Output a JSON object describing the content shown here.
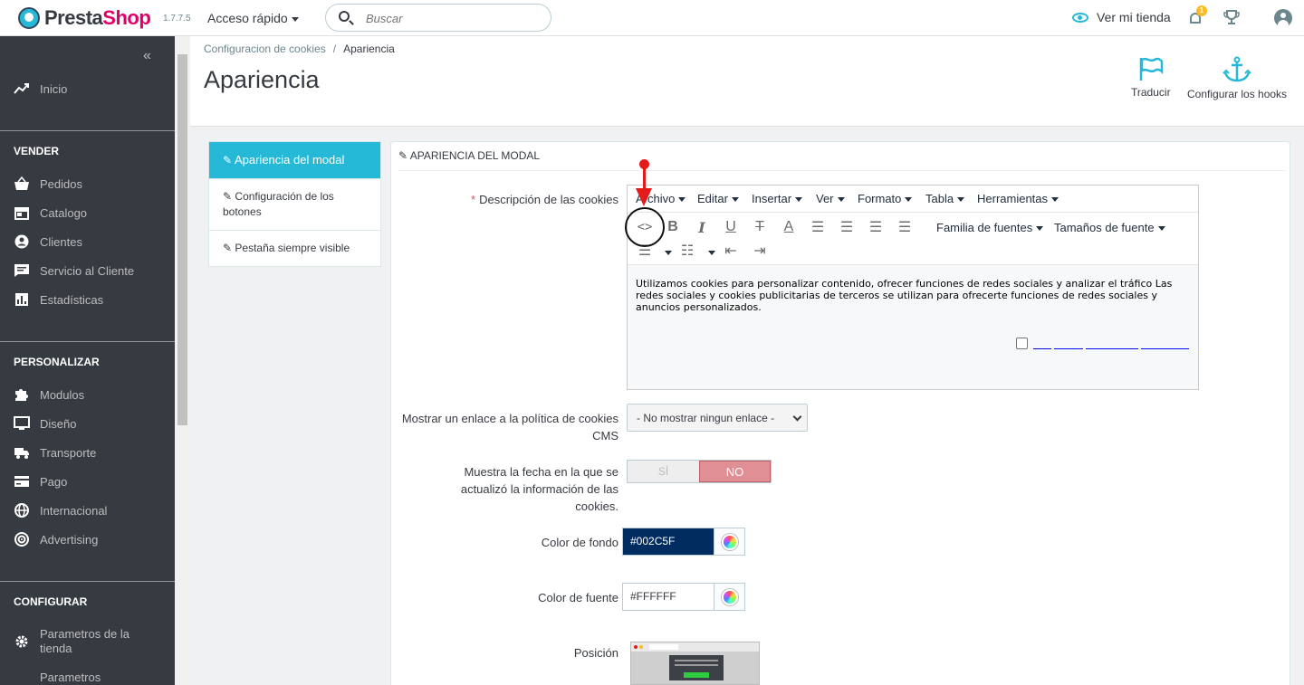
{
  "header": {
    "logo_name": "PrestaShop",
    "logo_presta": "Presta",
    "logo_shop": "Shop",
    "version": "1.7.7.5",
    "quick_access": "Acceso rápido",
    "search_placeholder": "Buscar",
    "view_shop": "Ver mi tienda",
    "notifications_count": "1"
  },
  "sidebar": {
    "collapse_icon": "«",
    "home": "Inicio",
    "sections": [
      {
        "title": "VENDER",
        "items": [
          "Pedidos",
          "Catalogo",
          "Clientes",
          "Servicio al Cliente",
          "Estadísticas"
        ]
      },
      {
        "title": "PERSONALIZAR",
        "items": [
          "Modulos",
          "Diseño",
          "Transporte",
          "Pago",
          "Internacional",
          "Advertising"
        ]
      },
      {
        "title": "CONFIGURAR",
        "items": [
          "Parametros de la tienda",
          "Parametros"
        ]
      }
    ]
  },
  "pagehead": {
    "breadcrumb": [
      "Configuracion de cookies",
      "Apariencia"
    ],
    "breadcrumb_sep": "/",
    "title": "Apariencia",
    "toolbar": {
      "translate": "Traducir",
      "hooks": "Configurar los hooks"
    }
  },
  "tabs": [
    "Apariencia del modal",
    "Configuración de los botones",
    "Pestaña siempre visible"
  ],
  "panel": {
    "heading": "APARIENCIA DEL MODAL",
    "description_label": "Descripción de las cookies",
    "required_mark": "*",
    "editor": {
      "menus": [
        "Archivo",
        "Editar",
        "Insertar",
        "Ver",
        "Formato",
        "Tabla",
        "Herramientas"
      ],
      "font_family": "Familia de fuentes",
      "font_size": "Tamaños de fuente",
      "content": "Utilizamos cookies para personalizar contenido, ofrecer funciones de redes sociales y analizar el tráfico Las redes sociales y cookies publicitarias de terceros se utilizan para ofrecerte funciones de redes sociales y anuncios personalizados."
    },
    "cms_link_label": "Mostrar un enlace a la política de cookies CMS",
    "cms_link_value": "- No mostrar ningun enlace -",
    "date_label": "Muestra la fecha en la que se actualizó la información de las cookies.",
    "switch_yes": "SÍ",
    "switch_no": "NO",
    "bg_color_label": "Color de fondo",
    "bg_color_value": "#002C5F",
    "font_color_label": "Color de fuente",
    "font_color_value": "#FFFFFF",
    "position_label": "Posición"
  },
  "colors": {
    "accent": "#25b9d7",
    "sidebar": "#363a41",
    "no_active": "#e08f95",
    "annotation": "#e31b1b"
  }
}
